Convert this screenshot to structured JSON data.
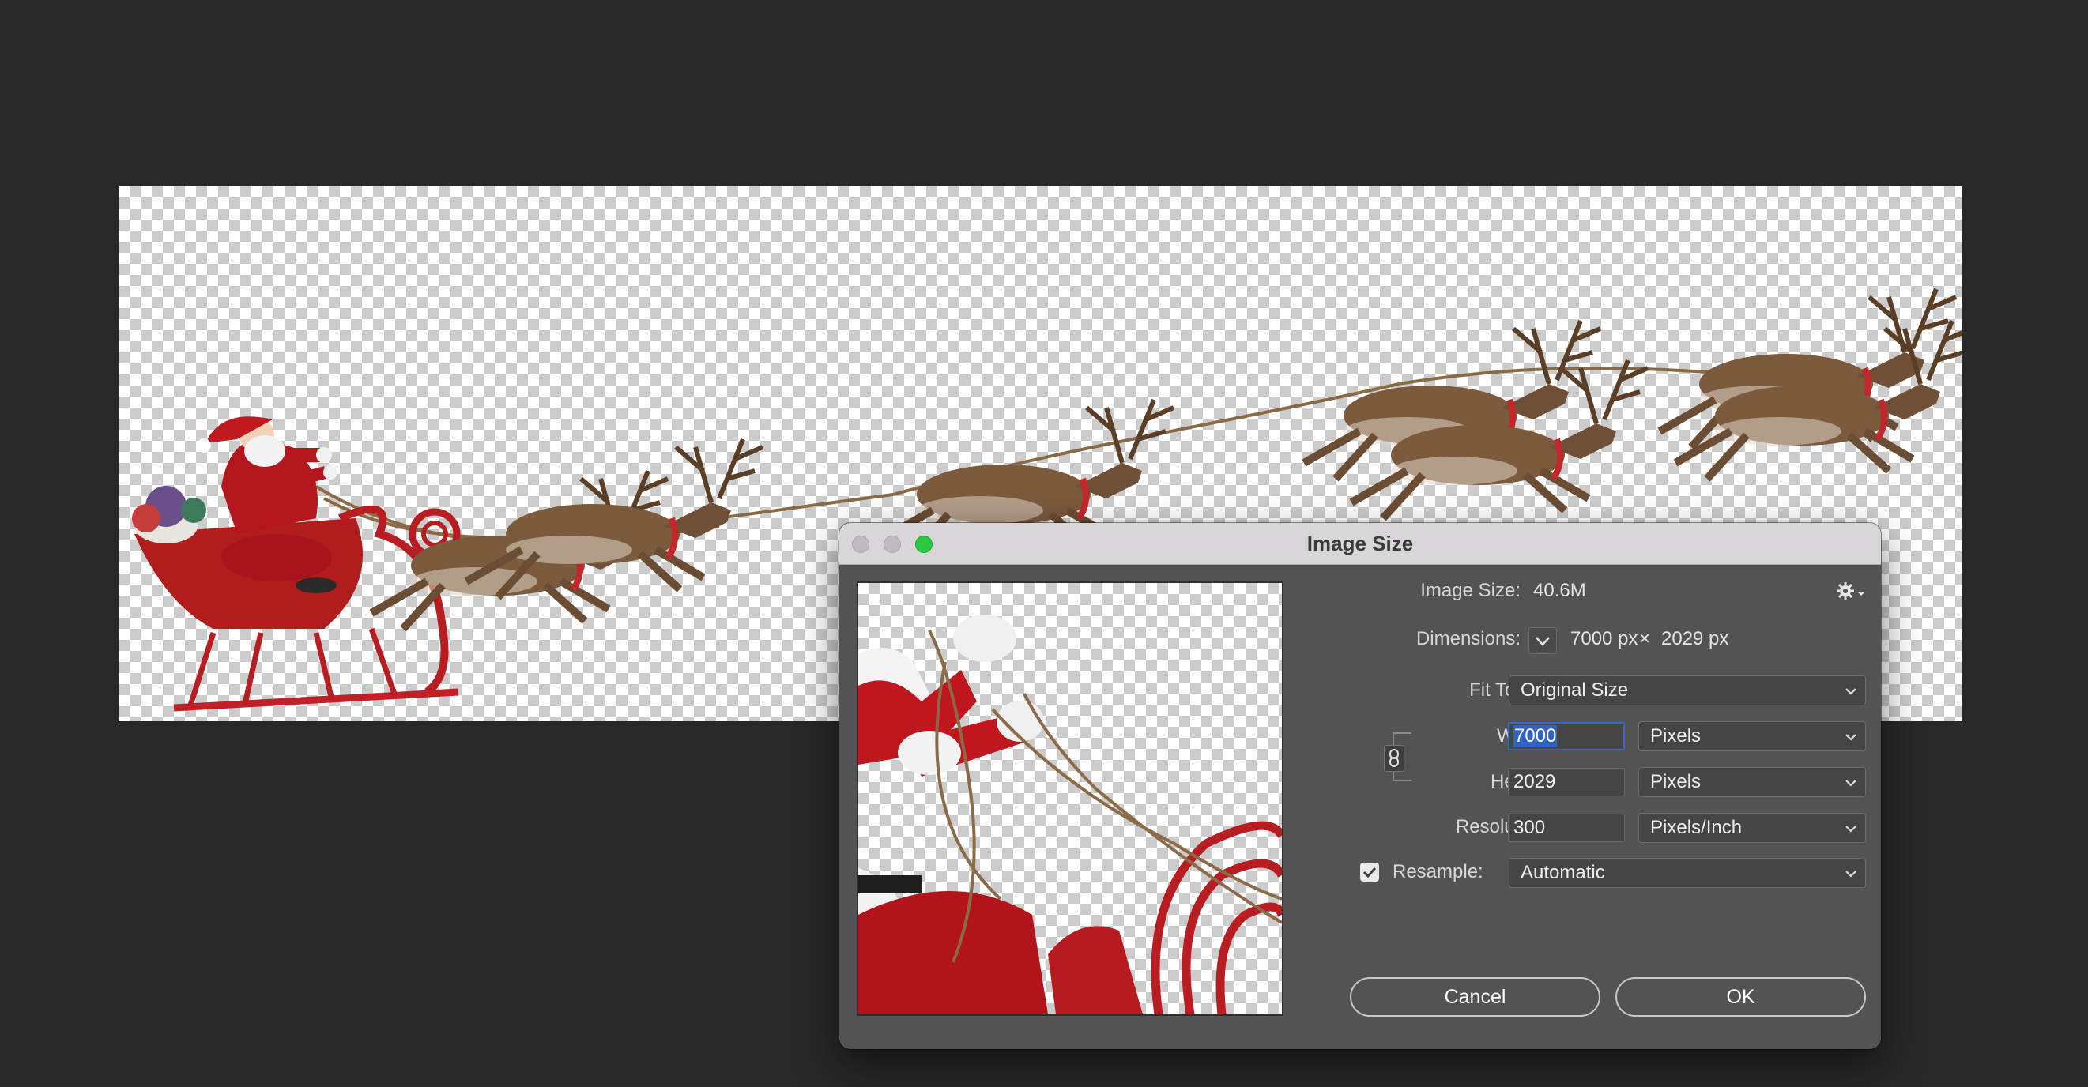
{
  "dialog": {
    "title": "Image Size",
    "image_size_label": "Image Size:",
    "image_size_value": "40.6M",
    "dimensions_label": "Dimensions:",
    "dimensions_width": "7000 px",
    "dimensions_times": "×",
    "dimensions_height": "2029 px",
    "fit_to_label": "Fit To:",
    "fit_to_value": "Original Size",
    "width_label": "Width:",
    "width_value": "7000",
    "width_unit": "Pixels",
    "height_label": "Height:",
    "height_value": "2029",
    "height_unit": "Pixels",
    "resolution_label": "Resolution:",
    "resolution_value": "300",
    "resolution_unit": "Pixels/Inch",
    "resample_label": "Resample:",
    "resample_checked": true,
    "resample_value": "Automatic",
    "cancel_label": "Cancel",
    "ok_label": "OK"
  },
  "icons": {
    "settings": "gear-icon",
    "dimensions_menu": "chevron-down-icon",
    "constrain": "link-icon",
    "check": "checkmark-icon"
  },
  "colors": {
    "background": "#282828",
    "dialog": "#535353",
    "titlebar": "#d9d6d9",
    "zoom_button": "#2ac840",
    "focus_ring": "#2f6bd4",
    "selection": "#2f63c6"
  }
}
